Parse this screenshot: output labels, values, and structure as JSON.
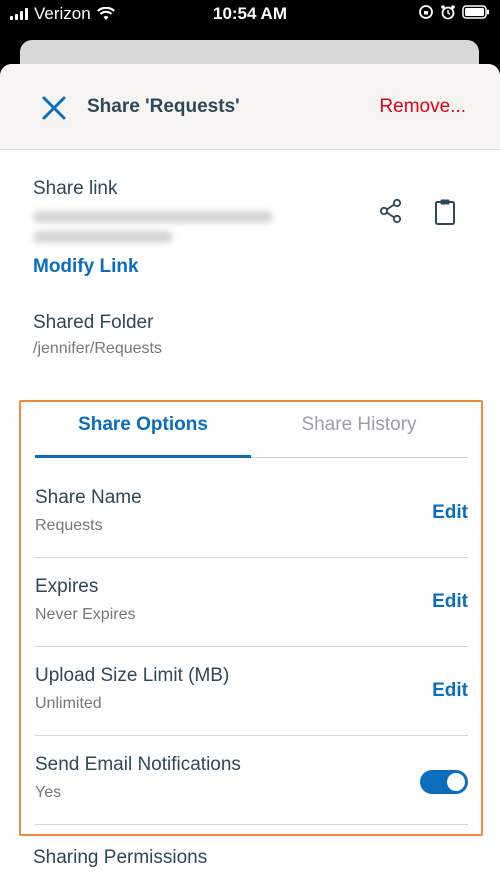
{
  "status_bar": {
    "carrier": "Verizon",
    "time": "10:54 AM"
  },
  "header": {
    "title": "Share 'Requests'",
    "remove_label": "Remove..."
  },
  "share_link": {
    "label": "Share link",
    "modify_label": "Modify Link"
  },
  "shared_folder": {
    "label": "Shared Folder",
    "path": "/jennifer/Requests"
  },
  "tabs": [
    {
      "label": "Share Options",
      "active": true
    },
    {
      "label": "Share History",
      "active": false
    }
  ],
  "options": [
    {
      "title": "Share Name",
      "value": "Requests",
      "action": "Edit"
    },
    {
      "title": "Expires",
      "value": "Never Expires",
      "action": "Edit"
    },
    {
      "title": "Upload Size Limit (MB)",
      "value": "Unlimited",
      "action": "Edit"
    },
    {
      "title": "Send Email Notifications",
      "value": "Yes",
      "toggle_on": true
    }
  ],
  "sharing_permissions_label": "Sharing Permissions",
  "colors": {
    "accent": "#0a6ebd",
    "danger": "#e3001b",
    "highlight": "#f08a3c",
    "text": "#2f4858",
    "muted": "#777777"
  },
  "icons": [
    "close-icon",
    "share-icon",
    "clipboard-icon",
    "wifi-icon",
    "battery-icon",
    "alarm-icon",
    "lock-rotation-icon"
  ]
}
